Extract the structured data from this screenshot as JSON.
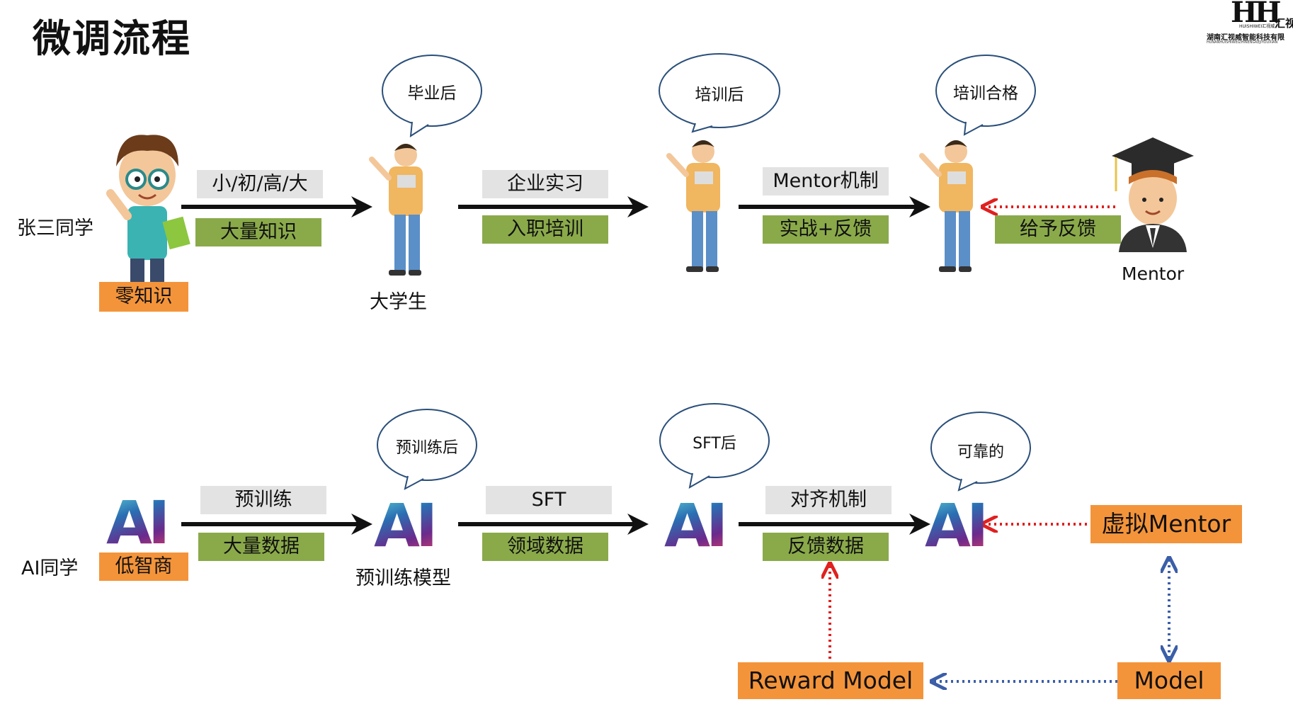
{
  "title": "微调流程",
  "logo": {
    "brand": "汇视",
    "line1": "HUISHIWEI汇视威",
    "line2": "湖南汇视威智能科技有限",
    "line3": "HUNANHUISHIWEIZHINENGKEJIYOUXIAN"
  },
  "top_row": {
    "row_label": "张三同学",
    "start_badge": "零知识",
    "student_label": "大学生",
    "mentor_label": "Mentor",
    "steps": [
      {
        "grey": "小/初/高/大",
        "green": "大量知识"
      },
      {
        "grey": "企业实习",
        "green": "入职培训"
      },
      {
        "grey": "Mentor机制",
        "green": "实战+反馈"
      }
    ],
    "feedback_label": "给予反馈",
    "bubbles": [
      "毕业后",
      "培训后",
      "培训合格"
    ]
  },
  "bottom_row": {
    "row_label": "AI同学",
    "start_badge": "低智商",
    "ai_text": "AI",
    "pretrained_label": "预训练模型",
    "steps": [
      {
        "grey": "预训练",
        "green": "大量数据"
      },
      {
        "grey": "SFT",
        "green": "领域数据"
      },
      {
        "grey": "对齐机制",
        "green": "反馈数据"
      }
    ],
    "bubbles": [
      "预训练后",
      "SFT后",
      "可靠的"
    ],
    "virtual_mentor": "虚拟Mentor",
    "reward_model": "Reward Model",
    "model": "Model"
  },
  "colors": {
    "green": "#8aaa4a",
    "grey": "#e3e3e3",
    "orange": "#f4943a",
    "red_arrow": "#e02020",
    "blue_arrow": "#3b5ea8"
  }
}
